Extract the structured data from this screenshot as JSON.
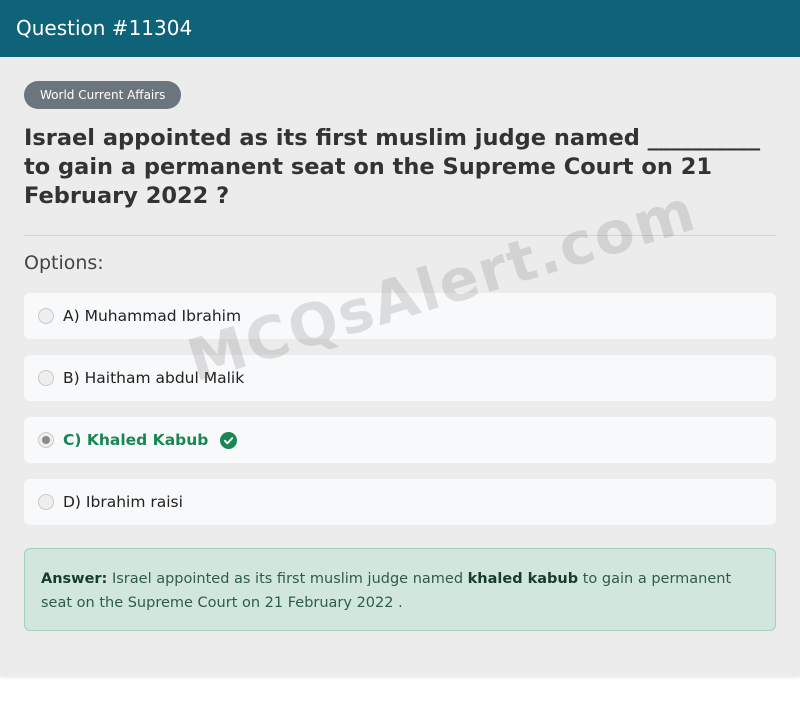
{
  "header": {
    "title": "Question #11304"
  },
  "category": {
    "label": "World Current Affairs"
  },
  "question": {
    "text": "Israel appointed as its first muslim judge named __________ to gain a permanent seat on the Supreme Court on 21 February 2022 ?"
  },
  "options_label": "Options:",
  "options": [
    {
      "text": "A) Muhammad Ibrahim",
      "selected": false,
      "correct": false
    },
    {
      "text": "B) Haitham abdul Malik",
      "selected": false,
      "correct": false
    },
    {
      "text": "C) Khaled Kabub",
      "selected": true,
      "correct": true,
      "icon": "check-circle-icon"
    },
    {
      "text": "D) Ibrahim raisi",
      "selected": false,
      "correct": false
    }
  ],
  "answer": {
    "label": "Answer:",
    "text_before": " Israel appointed as its first muslim judge named ",
    "highlight": "khaled kabub",
    "text_after": " to gain a permanent seat on the Supreme Court on 21 February 2022 ."
  },
  "watermark": "MCQsAlert.com",
  "colors": {
    "header_bg": "#0e6378",
    "tag_bg": "#6c757d",
    "correct_green": "#198754",
    "answer_bg": "#d1e7dd"
  }
}
